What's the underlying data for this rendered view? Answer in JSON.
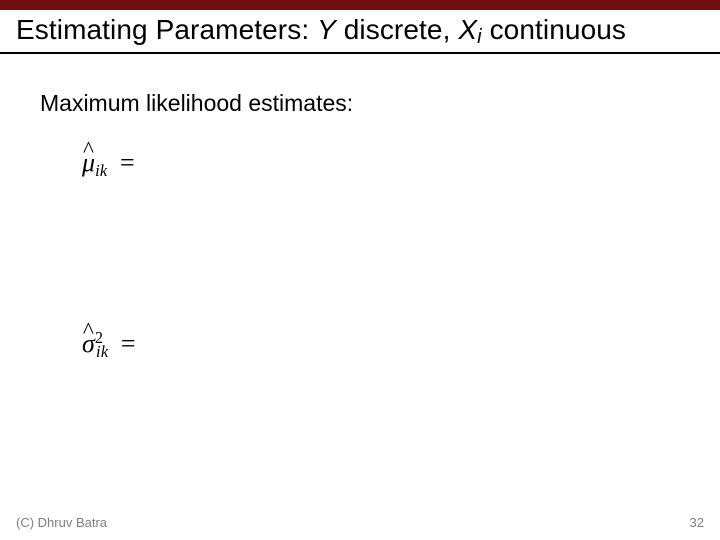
{
  "title": {
    "prefix": "Estimating Parameters: ",
    "y_var": "Y",
    "mid": " discrete, ",
    "x_var": "X",
    "x_sub": "i",
    "suffix": " continuous"
  },
  "body": {
    "mle_text": "Maximum likelihood estimates:"
  },
  "equations": {
    "mu": {
      "symbol": "μ",
      "hat": "^",
      "sub": "ik",
      "eq": "="
    },
    "sigma": {
      "symbol": "σ",
      "hat": "^",
      "sup": "2",
      "sub": "ik",
      "eq": "="
    }
  },
  "footer": {
    "copyright": "(C) Dhruv Batra",
    "page": "32"
  }
}
